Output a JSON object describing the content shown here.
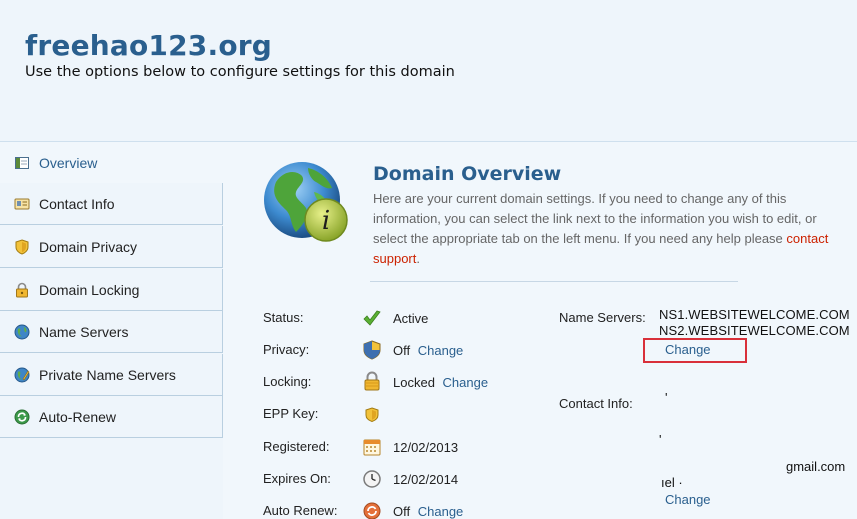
{
  "header": {
    "title": "freehao123.org",
    "subtitle": "Use the options below to configure settings for this domain"
  },
  "sidebar": {
    "items": [
      {
        "label": "Overview",
        "icon": "overview-icon"
      },
      {
        "label": "Contact Info",
        "icon": "contact-card-icon"
      },
      {
        "label": "Domain Privacy",
        "icon": "shield-icon"
      },
      {
        "label": "Domain Locking",
        "icon": "lock-icon"
      },
      {
        "label": "Name Servers",
        "icon": "globe-icon"
      },
      {
        "label": "Private Name Servers",
        "icon": "globe-pencil-icon"
      },
      {
        "label": "Auto-Renew",
        "icon": "renew-arrows-icon"
      }
    ],
    "active": "Overview"
  },
  "overview": {
    "title": "Domain Overview",
    "intro_text": "Here are your current domain settings. If you need to change any of this information, you can select the link next to the information you wish to edit, or select the appropriate tab on the left menu. If you need any help please ",
    "contact_link": "contact support",
    "intro_end": "."
  },
  "details": {
    "status": {
      "label": "Status:",
      "value": "Active"
    },
    "privacy": {
      "label": "Privacy:",
      "value": "Off",
      "action": "Change"
    },
    "locking": {
      "label": "Locking:",
      "value": "Locked",
      "action": "Change"
    },
    "epp_key": {
      "label": "EPP Key:",
      "value": ""
    },
    "registered": {
      "label": "Registered:",
      "value": "12/02/2013"
    },
    "expires": {
      "label": "Expires On:",
      "value": "12/02/2014"
    },
    "auto_renew": {
      "label": "Auto Renew:",
      "value": "Off",
      "action": "Change"
    }
  },
  "name_servers": {
    "label": "Name Servers:",
    "values": [
      "NS1.WEBSITEWELCOME.COM",
      "NS2.WEBSITEWELCOME.COM"
    ],
    "action": "Change"
  },
  "contact_info": {
    "label": "Contact Info:",
    "fragments": [
      "'",
      "'",
      "gmail.com",
      "ıel ·",
      "Change"
    ]
  },
  "colors": {
    "accent": "#2a5f8e",
    "highlight_box": "#d9303a",
    "link_red": "#cc2200",
    "background": "#f1f7fc"
  }
}
